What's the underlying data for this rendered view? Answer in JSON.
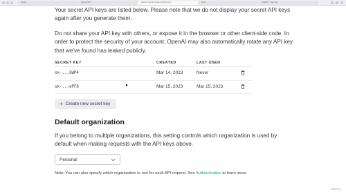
{
  "browser": {
    "tabs": [
      "Sheets",
      "OpenAI API",
      "platform.openai.com/account/api-keys",
      "Tools",
      "ChatGPT - New Tab"
    ]
  },
  "intro": {
    "paragraph1": "Your secret API keys are listed below. Please note that we do not display your secret API keys again after you generate them.",
    "paragraph2": "Do not share your API key with others, or expose it in the browser or other client-side code. In order to protect the security of your account, OpenAI may also automatically rotate any API key that we've found has leaked publicly."
  },
  "keys_table": {
    "headers": {
      "key": "SECRET KEY",
      "created": "CREATED",
      "last_used": "LAST USED"
    },
    "rows": [
      {
        "key": "sk-...5WP4",
        "created": "Mar 14, 2023",
        "last_used": "Never"
      },
      {
        "key": "sk-...ePF8",
        "created": "Mar 15, 2023",
        "last_used": "Mar 15, 2023"
      }
    ]
  },
  "create_button": {
    "icon": "plus-icon",
    "label": "Create new secret key"
  },
  "default_org": {
    "title": "Default organization",
    "description": "If you belong to multiple organizations, this setting controls which organization is used by default when making requests with the API keys above.",
    "selected": "Personal",
    "note_prefix": "Note: You can also specify which organization to use for each API request. See ",
    "note_link": "Authentication",
    "note_suffix": " to learn more."
  },
  "watermark": "Udemy",
  "colors": {
    "link": "#10a37f",
    "button_bg": "#ececf1",
    "text": "#353740"
  }
}
